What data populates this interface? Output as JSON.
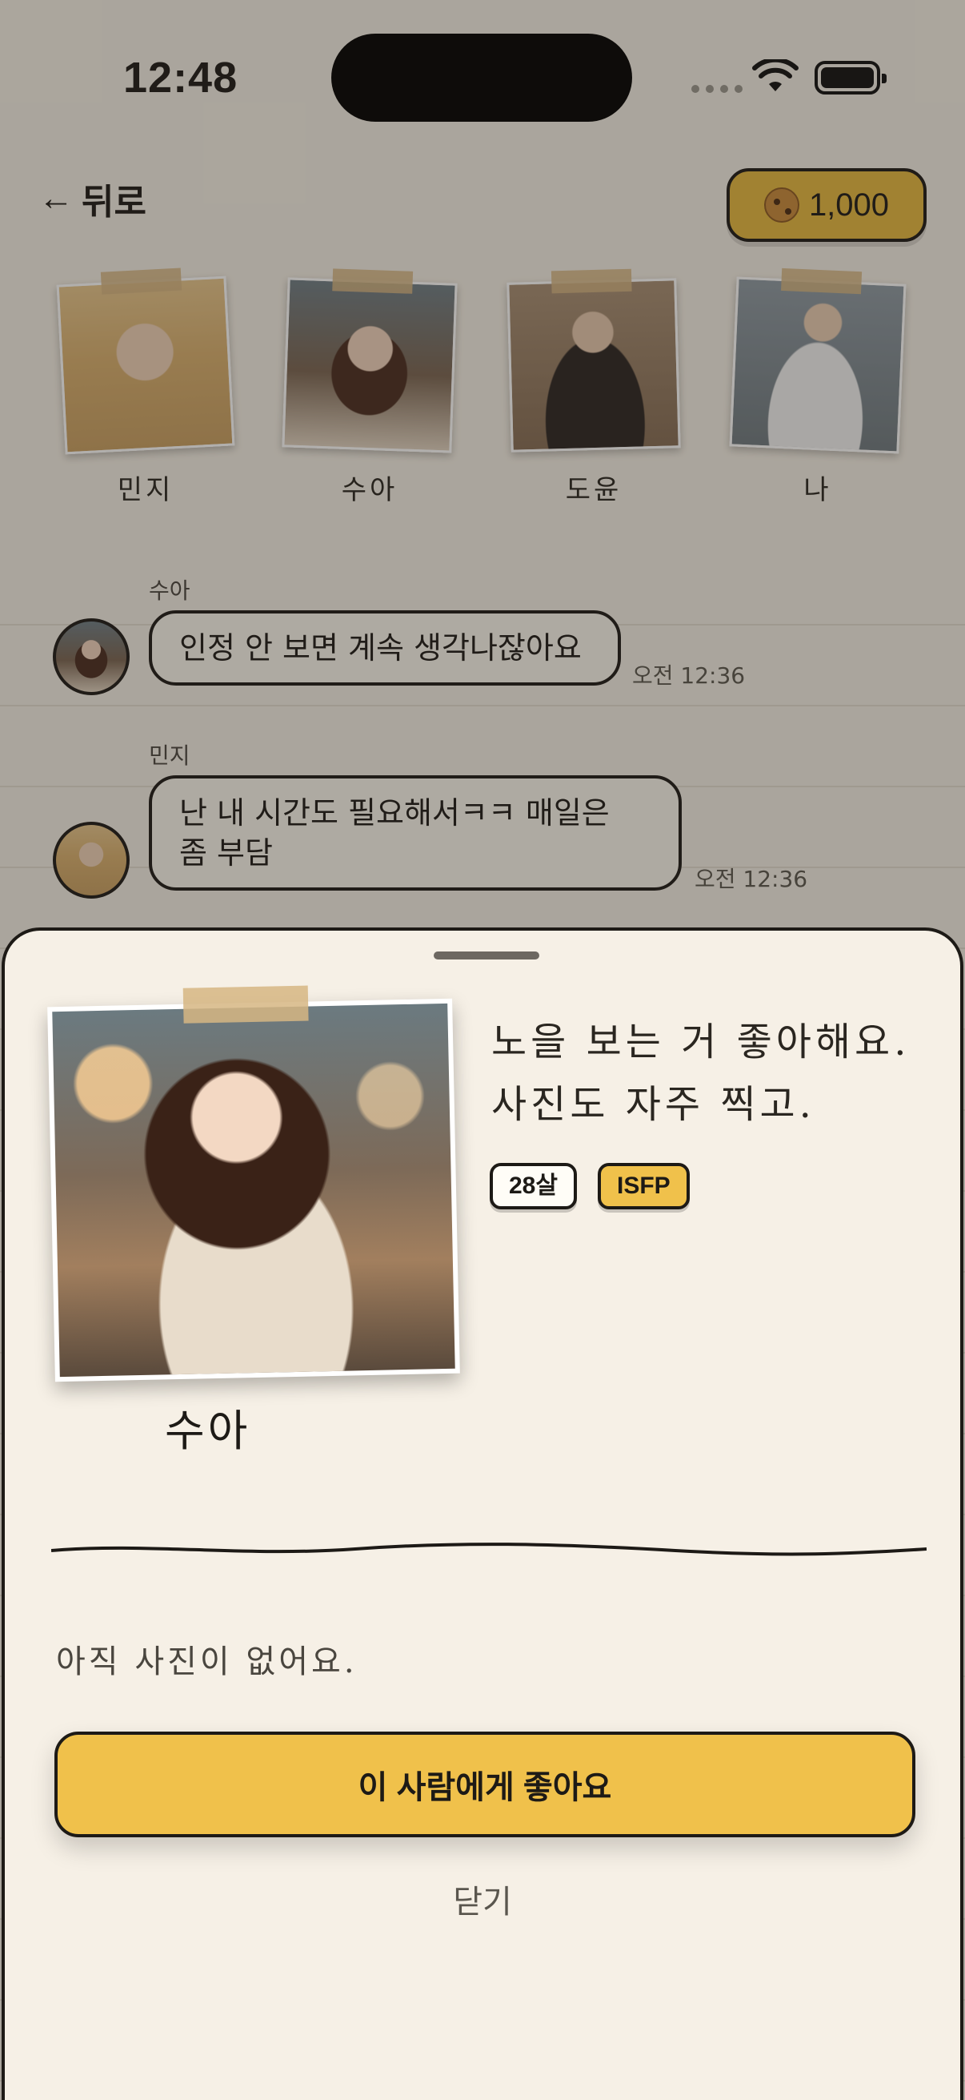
{
  "status_bar": {
    "time": "12:48"
  },
  "header": {
    "back_label": "뒤로",
    "cookie_count": "1,000"
  },
  "members": [
    {
      "name": "민지"
    },
    {
      "name": "수아"
    },
    {
      "name": "도윤"
    },
    {
      "name": "나"
    }
  ],
  "messages": [
    {
      "sender": "수아",
      "text": "인정 안 보면 계속 생각나잖아요",
      "time": "오전 12:36"
    },
    {
      "sender": "민지",
      "line1": "난 내 시간도 필요해서ㅋㅋ 매일은",
      "line2": "좀 부담",
      "time": "오전 12:36"
    }
  ],
  "profile_sheet": {
    "name": "수아",
    "bio_line1": "노을 보는 거 좋아해요.",
    "bio_line2": "사진도 자주 찍고.",
    "age_tag": "28살",
    "mbti_tag": "ISFP",
    "no_photos_text": "아직 사진이 없어요.",
    "like_button": "이 사람에게 좋아요",
    "close_button": "닫기"
  },
  "colors": {
    "accent": "#f0c14b",
    "outline": "#1d1a16",
    "paper": "#f6f0e6"
  }
}
